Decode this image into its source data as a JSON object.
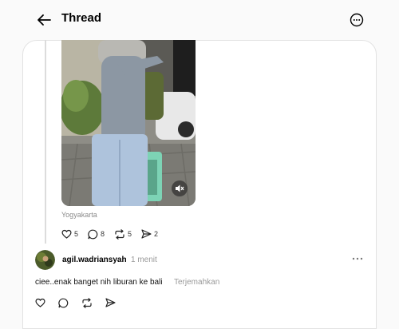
{
  "header": {
    "title": "Thread",
    "back_icon": "arrow-left-icon",
    "more_icon": "more-circle-icon"
  },
  "post": {
    "location": "Yogyakarta",
    "media_mute_icon": "mute-icon",
    "actions": {
      "likes": "5",
      "comments": "8",
      "reposts": "5",
      "shares": "2"
    }
  },
  "reply": {
    "username": "agil.wadriansyah",
    "time": "1 menit",
    "text": "ciee..enak banget nih liburan ke bali",
    "translate_label": "Terjemahkan"
  },
  "colors": {
    "background": "#fafafa",
    "muted_text": "#999999",
    "border": "#e2e2e2"
  }
}
